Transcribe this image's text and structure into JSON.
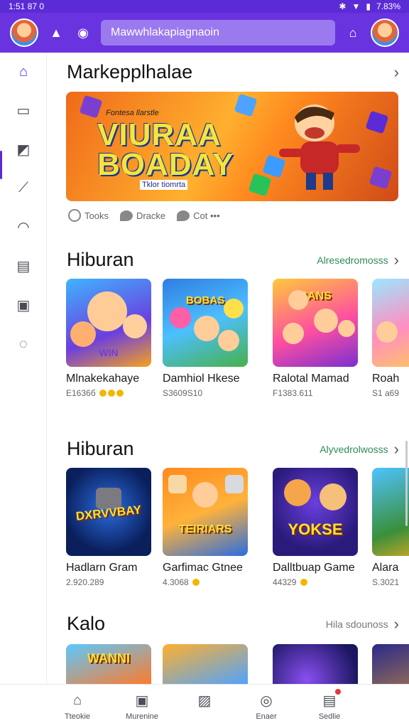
{
  "status_bar": {
    "time": "1:51 87 0",
    "battery": "7.83%"
  },
  "app_bar": {
    "search_text": "Mawwhlakapiagnaoin"
  },
  "sections": [
    {
      "title": "Markepplhalae"
    },
    {
      "title": "Hiburan",
      "see_all": "Alresedromosss"
    },
    {
      "title": "Hiburan",
      "see_all": "Alyvedrolwosss"
    },
    {
      "title": "Kalo",
      "see_all": "Hila sdounoss"
    }
  ],
  "banner": {
    "subtitle": "Fontesa llarstle",
    "headline_1": "VIURAA",
    "headline_2": "BOADAY",
    "tag_a": "Tklor",
    "tag_b": "tiomrta"
  },
  "banner_meta": [
    {
      "label": "Tooks",
      "icon": "circle-icon"
    },
    {
      "label": "Dracke",
      "icon": "chat-icon"
    },
    {
      "label": "Cot •••",
      "icon": "comment-icon"
    }
  ],
  "row1": [
    {
      "title": "Mlnakekahaye",
      "meta": "E1636б",
      "art": "WIN"
    },
    {
      "title": "Damhiol Hkese",
      "meta": "S3609S10",
      "art": "BOBAS"
    },
    {
      "title": "Ralotal Mamad",
      "meta": "F1383.611",
      "art": "BANS"
    },
    {
      "title": "Roah",
      "meta": "S1 a69",
      "art": ""
    }
  ],
  "row2": [
    {
      "title": "Hadlarn Gram",
      "meta": "2.920.289",
      "art": "DXRVVBAY"
    },
    {
      "title": "Garfimac Gtnee",
      "meta": "4.3068",
      "art": "TEIRIARS"
    },
    {
      "title": "Dalltbuap Game",
      "meta": "44329",
      "art": "YOKSE"
    },
    {
      "title": "Alara",
      "meta": "S.3021",
      "art": ""
    }
  ],
  "row3": [
    {
      "art": "WANNI"
    },
    {
      "art": ""
    },
    {
      "art": ""
    },
    {
      "art": ""
    }
  ],
  "bottom_nav": [
    {
      "label": "Tteokie",
      "icon": "home-icon"
    },
    {
      "label": "Murenine",
      "icon": "book-icon"
    },
    {
      "label": "",
      "icon": "image-icon"
    },
    {
      "label": "Enaer",
      "icon": "pin-icon"
    },
    {
      "label": "Sedlie",
      "icon": "inbox-icon",
      "badge": true
    }
  ],
  "colors": {
    "brand": "#6a33e0",
    "accent_green": "#2e8b57"
  }
}
